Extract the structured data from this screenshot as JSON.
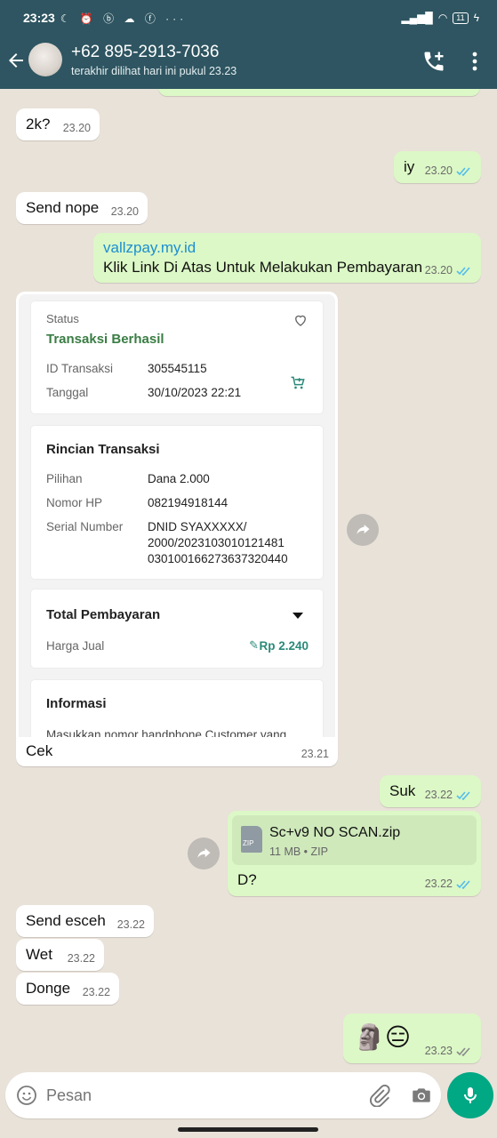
{
  "status_bar": {
    "time": "23:23",
    "battery": "11"
  },
  "header": {
    "contact_name": "+62 895-2913-7036",
    "last_seen": "terakhir dilihat hari ini pukul 23.23"
  },
  "messages": [
    {
      "text": "2k?",
      "time": "23.20"
    },
    {
      "text": "iy",
      "time": "23.20"
    },
    {
      "text": "Send nope",
      "time": "23.20"
    },
    {
      "link": "vallzpay.my.id",
      "text": "Klik Link Di Atas Untuk Melakukan Pembayaran",
      "time": "23.20"
    },
    {
      "text": "Cek",
      "time": "23.21"
    },
    {
      "text": "Suk",
      "time": "23.22"
    },
    {
      "file_name": "Sc+v9 NO SCAN.zip",
      "file_meta": "11 MB • ZIP",
      "file_ext": "ZIP",
      "text": "D?",
      "time": "23.22"
    },
    {
      "text": "Send esceh",
      "time": "23.22"
    },
    {
      "text": "Wet",
      "time": "23.22"
    },
    {
      "text": "Donge",
      "time": "23.22"
    },
    {
      "emoji": "🗿😑",
      "time": "23.23"
    }
  ],
  "receipt": {
    "status_label": "Status",
    "status_value": "Transaksi Berhasil",
    "id_label": "ID Transaksi",
    "id_value": "305545115",
    "date_label": "Tanggal",
    "date_value": "30/10/2023 22:21",
    "details_title": "Rincian Transaksi",
    "option_label": "Pilihan",
    "option_value": "Dana 2.000",
    "phone_label": "Nomor HP",
    "phone_value": "082194918144",
    "serial_label": "Serial Number",
    "serial_line1": "DNID SYAXXXXX/",
    "serial_line2": "2000/2023103010121481",
    "serial_line3": "030100166273637320440",
    "total_title": "Total Pembayaran",
    "price_label": "Harga Jual",
    "price_value": "Rp 2.240",
    "info_title": "Informasi",
    "info_text": "Masukkan nomor handphone Customer yang"
  },
  "composer": {
    "placeholder": "Pesan"
  },
  "colors": {
    "header": "#2e5561",
    "outgoing": "#dcf8c6",
    "incoming": "#ffffff",
    "read_ticks": "#53bdeb",
    "success": "#3a7d44",
    "mic": "#00a884"
  }
}
